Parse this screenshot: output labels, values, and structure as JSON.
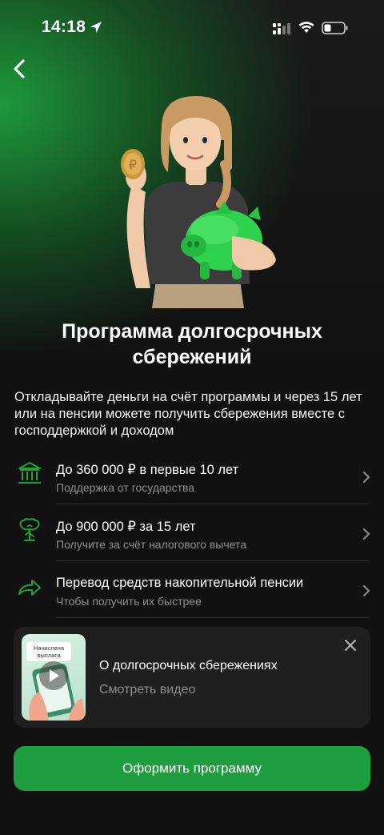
{
  "status_bar": {
    "time": "14:18"
  },
  "header": {
    "back_icon": "chevron-left-icon"
  },
  "hero": {
    "image": "woman-with-coin-and-piggy-bank"
  },
  "page": {
    "title_line1": "Программа долгосрочных",
    "title_line2": "сбережений",
    "intro": "Откладывайте деньги на счёт программы и через 15 лет или на пенсии можете получить сбережения вместе с господдержкой и доходом"
  },
  "features": [
    {
      "icon": "bank-icon",
      "title": "До 360 000 ₽ в первые 10 лет",
      "subtitle": "Поддержка от государства"
    },
    {
      "icon": "money-tree-icon",
      "title": "До 900 000 ₽ за 15 лет",
      "subtitle": "Получите за счёт налогового вычета"
    },
    {
      "icon": "transfer-arrow-icon",
      "title": "Перевод средств накопительной пенсии",
      "subtitle": "Чтобы получить их быстрее"
    }
  ],
  "video_card": {
    "thumb_label": "Начислена выплата",
    "title": "О долгосрочных сбережениях",
    "subtitle": "Смотреть видео"
  },
  "cta": {
    "label": "Оформить программу"
  },
  "colors": {
    "accent": "#1f9e3f",
    "icon_green": "#21a038",
    "background": "#111111"
  }
}
